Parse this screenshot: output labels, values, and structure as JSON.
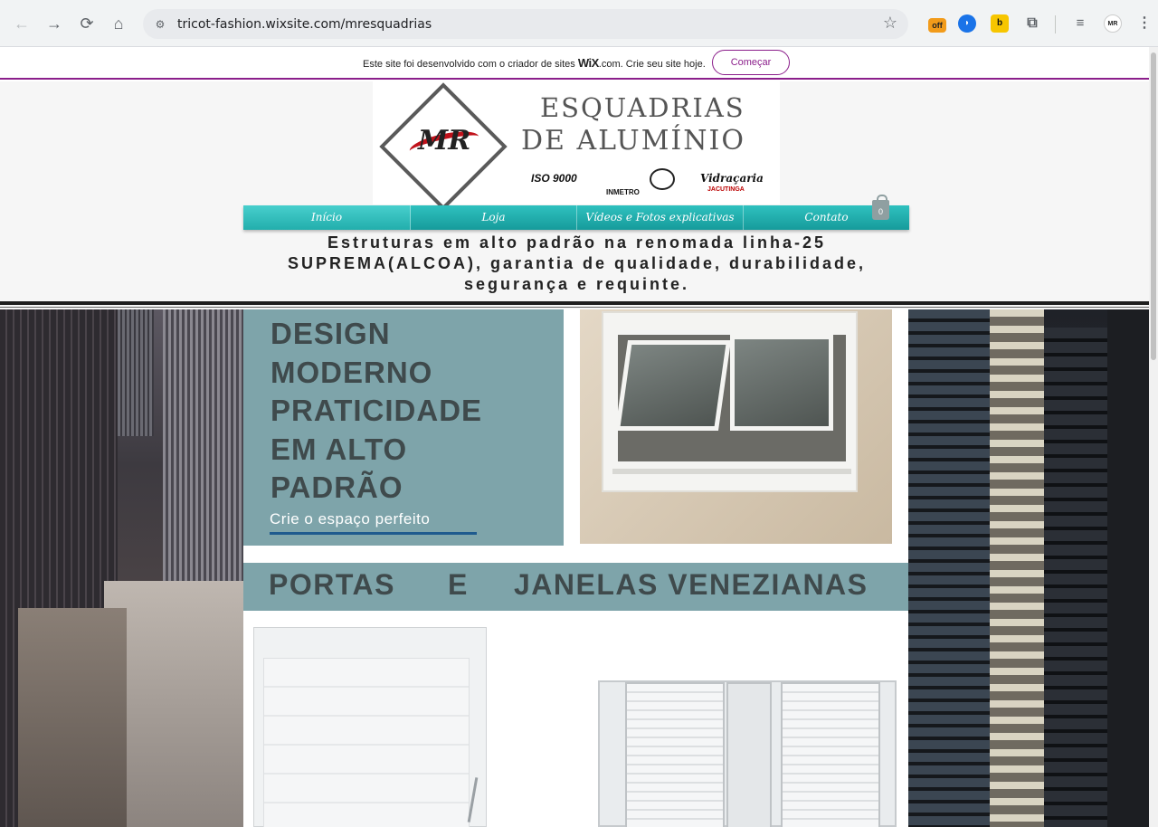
{
  "browser": {
    "url": "tricot-fashion.wixsite.com/mresquadrias",
    "back_icon": "←",
    "forward_icon": "→",
    "reload_icon": "⟳",
    "home_icon": "⌂",
    "star_icon": "☆",
    "ext_off_badge": "off"
  },
  "wix_banner": {
    "text_before": "Este site foi desenvolvido com o criador de sites",
    "brand": "WiX",
    "text_after": ".com. Crie seu site hoje.",
    "cta": "Começar"
  },
  "logo": {
    "mark": "MR",
    "line1": "ESQUADRIAS",
    "line2": "DE ALUMÍNIO",
    "cert1": "ISO 9000",
    "cert2": "INMETRO",
    "cert3": "Vidraçaria",
    "cert3_sub": "JACUTINGA"
  },
  "menu": {
    "items": [
      {
        "label": "Início",
        "active": true
      },
      {
        "label": "Loja",
        "active": false
      },
      {
        "label": "Vídeos e Fotos explicativas",
        "active": false
      },
      {
        "label": "Contato",
        "active": false
      }
    ],
    "cart_count": "0"
  },
  "tagline": "Estruturas em alto padrão na renomada linha-25 SUPREMA(ALCOA), garantia de qualidade, durabilidade, segurança e requinte.",
  "hero": {
    "title_lines": [
      "DESIGN",
      "MODERNO",
      "PRATICIDADE",
      "EM ALTO",
      "PADRÃO"
    ],
    "subtitle": "Crie o espaço perfeito"
  },
  "slideshow": {
    "prev_icon": "‹",
    "next_icon": "›"
  },
  "band": {
    "words": [
      "PORTAS",
      "E",
      "JANELAS VENEZIANAS"
    ]
  },
  "colors": {
    "accent_teal": "#2fc1bf",
    "hero_bg": "#7ea4aa",
    "wix_purple": "#8b1e8b"
  }
}
